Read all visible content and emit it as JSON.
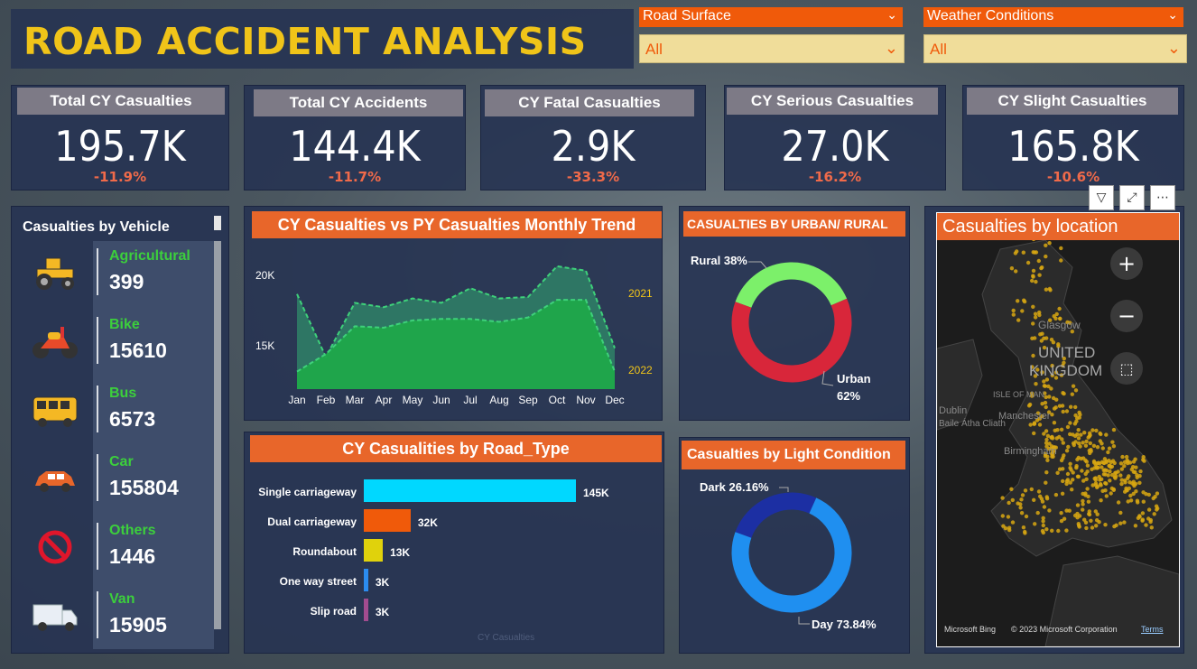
{
  "title": "ROAD ACCIDENT ANALYSIS",
  "slicers": [
    {
      "label": "Road Surface",
      "value": "All"
    },
    {
      "label": "Weather Conditions",
      "value": "All"
    }
  ],
  "kpis": [
    {
      "title": "Total CY Casualties",
      "value": "195.7K",
      "delta": "-11.9%"
    },
    {
      "title": "Total CY Accidents",
      "value": "144.4K",
      "delta": "-11.7%"
    },
    {
      "title": "CY Fatal Casualties",
      "value": "2.9K",
      "delta": "-33.3%"
    },
    {
      "title": "CY Serious Casualties",
      "value": "27.0K",
      "delta": "-16.2%"
    },
    {
      "title": "CY Slight Casualties",
      "value": "165.8K",
      "delta": "-10.6%"
    }
  ],
  "vehicles": {
    "title": "Casualties  by  Vehicle",
    "items": [
      {
        "name": "Agricultural",
        "value": "399",
        "icon": "tractor-icon"
      },
      {
        "name": "Bike",
        "value": "15610",
        "icon": "motorbike-icon"
      },
      {
        "name": "Bus",
        "value": "6573",
        "icon": "bus-icon"
      },
      {
        "name": "Car",
        "value": "155804",
        "icon": "car-icon"
      },
      {
        "name": "Others",
        "value": "1446",
        "icon": "no-entry-icon"
      },
      {
        "name": "Van",
        "value": "15905",
        "icon": "van-icon"
      }
    ]
  },
  "trend": {
    "title": "CY Casualties vs PY Casualties Monthly Trend",
    "y_ticks": [
      "20K",
      "15K"
    ],
    "series_labels": [
      "2021",
      "2022"
    ]
  },
  "road_type": {
    "title": "CY Casualities by Road_Type",
    "footer": "CY Casualties"
  },
  "urban_rural": {
    "title": "CASUALTIES BY URBAN/ RURAL",
    "labels": [
      "Rural 38%",
      "Urban",
      "62%"
    ]
  },
  "light": {
    "title": "Casualties by Light Condition",
    "labels": [
      "Dark 26.16%",
      "Day 73.84%"
    ]
  },
  "map": {
    "title": "Casualties by location",
    "place_labels": [
      "UNITED",
      "KINGDOM",
      "ISLE OF MAN",
      "Dublin",
      "Baile Átha Cliath",
      "Manchester",
      "Birmingham",
      "Glasgow"
    ],
    "attribution": "© 2023 Microsoft Corporation",
    "terms": "Terms",
    "brand": "Microsoft Bing"
  },
  "colors": {
    "accent_orange": "#e8662a",
    "title_yellow": "#f0c419",
    "panel": "#273452",
    "green_label": "#3ccf3c",
    "delta_red": "#f06a4a"
  },
  "chart_data": [
    {
      "type": "area",
      "title": "CY Casualties vs PY Casualties Monthly Trend",
      "categories": [
        "Jan",
        "Feb",
        "Mar",
        "Apr",
        "May",
        "Jun",
        "Jul",
        "Aug",
        "Sep",
        "Oct",
        "Nov",
        "Dec"
      ],
      "series": [
        {
          "name": "2021",
          "values": [
            18500,
            14200,
            17900,
            17600,
            18200,
            17900,
            18900,
            18200,
            18300,
            20400,
            20100,
            14800
          ]
        },
        {
          "name": "2022",
          "values": [
            13200,
            14400,
            16300,
            16200,
            16700,
            16800,
            16800,
            16600,
            16900,
            18100,
            18100,
            13200
          ]
        }
      ],
      "ylim": [
        12000,
        22000
      ]
    },
    {
      "type": "bar",
      "title": "CY Casualities by Road_Type",
      "categories": [
        "Single carriageway",
        "Dual carriageway",
        "Roundabout",
        "One way street",
        "Slip road"
      ],
      "values": [
        145000,
        32000,
        13000,
        3000,
        3000
      ],
      "value_labels": [
        "145K",
        "32K",
        "13K",
        "3K",
        "3K"
      ],
      "colors": [
        "#00d8ff",
        "#f05a0a",
        "#e0d20c",
        "#2b8cf0",
        "#a24c8f"
      ]
    },
    {
      "type": "pie",
      "title": "CASUALTIES BY URBAN/ RURAL",
      "categories": [
        "Rural",
        "Urban"
      ],
      "values": [
        38,
        62
      ],
      "colors": [
        "#7cf06a",
        "#d8263a"
      ]
    },
    {
      "type": "pie",
      "title": "Casualties by Light Condition",
      "categories": [
        "Dark",
        "Day"
      ],
      "values": [
        26.16,
        73.84
      ],
      "colors": [
        "#1c2fa3",
        "#1f8ff0"
      ]
    }
  ]
}
